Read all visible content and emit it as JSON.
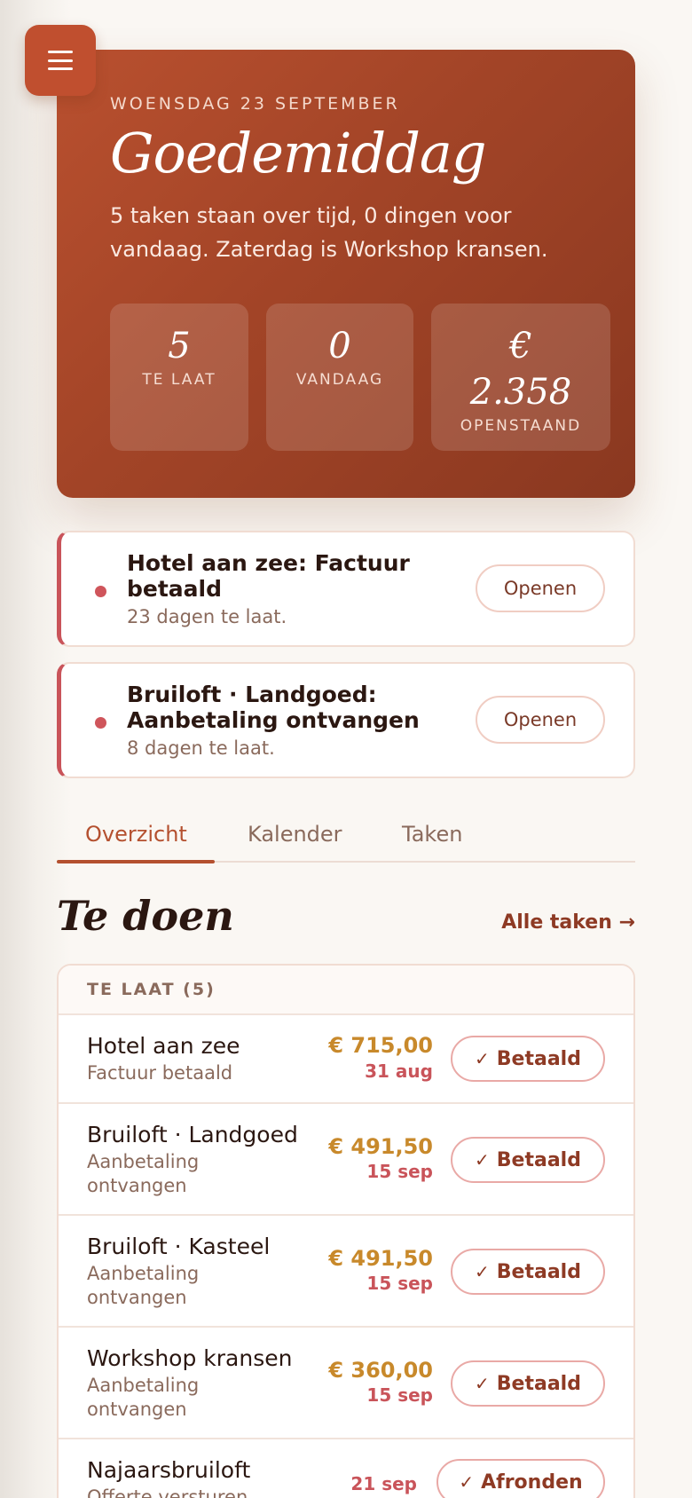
{
  "hero": {
    "date": "WOENSDAG 23 SEPTEMBER",
    "greeting": "Goedemiddag",
    "summary": "5 taken staan over tijd, 0 dingen voor vandaag. Zaterdag is Workshop kransen.",
    "stats": [
      {
        "value": "5",
        "label": "TE LAAT"
      },
      {
        "value": "0",
        "label": "VANDAAG"
      },
      {
        "value_line1": "€",
        "value_line2": "2.358",
        "label": "OPENSTAAND"
      }
    ]
  },
  "alerts": [
    {
      "title": "Hotel aan zee: Factuur betaald",
      "sub": "23 dagen te laat.",
      "button": "Openen"
    },
    {
      "title": "Bruiloft · Landgoed: Aanbetaling ontvangen",
      "sub": "8 dagen te laat.",
      "button": "Openen"
    }
  ],
  "tabs": [
    {
      "label": "Overzicht",
      "active": true
    },
    {
      "label": "Kalender",
      "active": false
    },
    {
      "label": "Taken",
      "active": false
    }
  ],
  "todo": {
    "title": "Te doen",
    "all_link": "Alle taken →",
    "group_label": "TE LAAT (5)",
    "rows": [
      {
        "name": "Hotel aan zee",
        "desc": "Factuur betaald",
        "amount": "€ 715,00",
        "due": "31 aug",
        "action": "Betaald"
      },
      {
        "name": "Bruiloft · Landgoed",
        "desc": "Aanbetaling ontvangen",
        "amount": "€ 491,50",
        "due": "15 sep",
        "action": "Betaald"
      },
      {
        "name": "Bruiloft · Kasteel",
        "desc": "Aanbetaling ontvangen",
        "amount": "€ 491,50",
        "due": "15 sep",
        "action": "Betaald"
      },
      {
        "name": "Workshop kransen",
        "desc": "Aanbetaling ontvangen",
        "amount": "€ 360,00",
        "due": "15 sep",
        "action": "Betaald"
      },
      {
        "name": "Najaarsbruiloft",
        "desc": "Offerte versturen",
        "amount": "",
        "due": "21 sep",
        "action": "Afronden"
      }
    ]
  },
  "icons": {
    "menu": "hamburger-menu-icon",
    "check": "check-icon",
    "dot": "overdue-dot-icon"
  },
  "colors": {
    "accent": "#b4502f",
    "overdue": "#c9545a",
    "amount": "#c8892b"
  }
}
